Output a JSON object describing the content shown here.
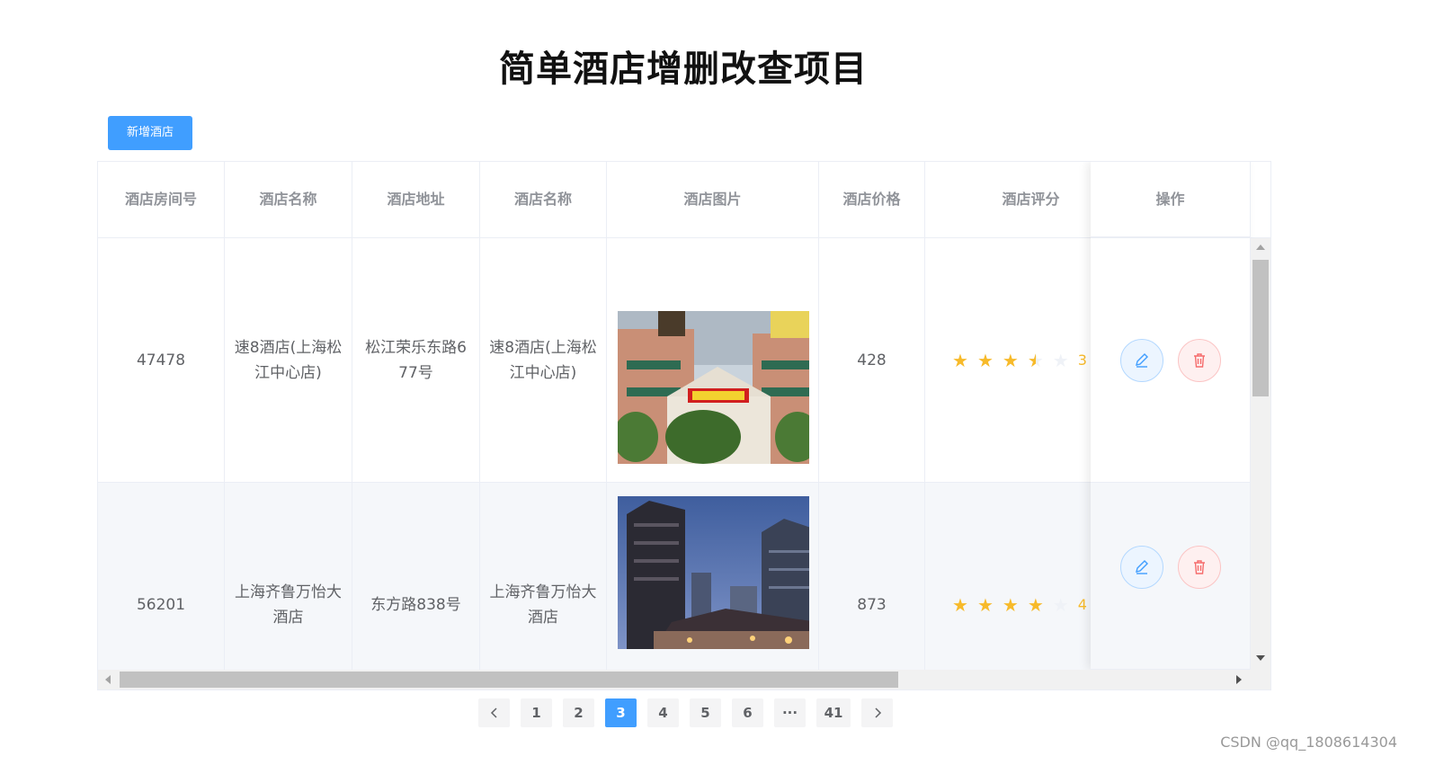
{
  "page_title": "简单酒店增删改查项目",
  "add_button_label": "新增酒店",
  "columns": [
    "酒店房间号",
    "酒店名称",
    "酒店地址",
    "酒店名称",
    "酒店图片",
    "酒店价格",
    "酒店评分"
  ],
  "op_column": "操作",
  "rows": [
    {
      "room": "47478",
      "name": "速8酒店(上海松江中心店)",
      "address": "松江荣乐东路677号",
      "name2": "速8酒店(上海松江中心店)",
      "price": "428",
      "rating": 3.5,
      "score_text": "3"
    },
    {
      "room": "56201",
      "name": "上海齐鲁万怡大酒店",
      "address": "东方路838号",
      "name2": "上海齐鲁万怡大酒店",
      "price": "873",
      "rating": 4,
      "score_text": "4"
    }
  ],
  "pagination": {
    "prev_icon": "chevron-left-icon",
    "pages": [
      "1",
      "2",
      "3",
      "4",
      "5",
      "6",
      "···",
      "41"
    ],
    "current": "3",
    "next_icon": "chevron-right-icon"
  },
  "watermark": "CSDN @qq_1808614304",
  "colors": {
    "primary": "#409eff",
    "star": "#f7ba2a",
    "danger": "#f56c6c"
  }
}
